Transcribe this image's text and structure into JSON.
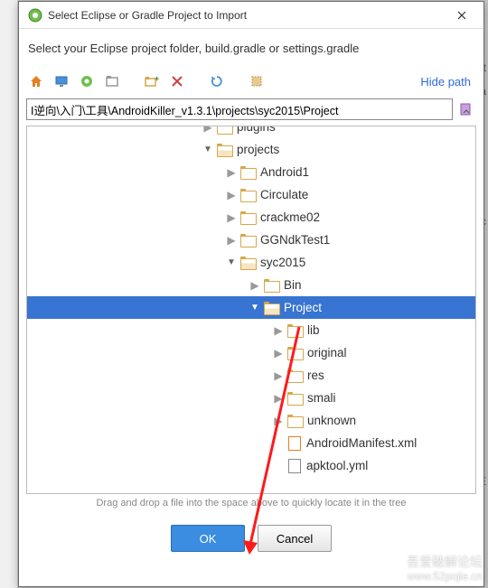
{
  "window": {
    "title": "Select Eclipse or Gradle Project to Import",
    "instruction": "Select your Eclipse project folder, build.gradle or settings.gradle"
  },
  "toolbar": {
    "hide_path": "Hide path"
  },
  "path": {
    "value": "I逆向\\入门\\工具\\AndroidKiller_v1.3.1\\projects\\syc2015\\Project"
  },
  "tree": {
    "items": [
      {
        "indent": 192,
        "arrow": "collapsed",
        "icon": "folder",
        "label": "plugins",
        "cut": true
      },
      {
        "indent": 192,
        "arrow": "expanded",
        "icon": "folder-open",
        "label": "projects"
      },
      {
        "indent": 218,
        "arrow": "collapsed",
        "icon": "folder",
        "label": "Android1"
      },
      {
        "indent": 218,
        "arrow": "collapsed",
        "icon": "folder",
        "label": "Circulate"
      },
      {
        "indent": 218,
        "arrow": "collapsed",
        "icon": "folder",
        "label": "crackme02"
      },
      {
        "indent": 218,
        "arrow": "collapsed",
        "icon": "folder",
        "label": "GGNdkTest1"
      },
      {
        "indent": 218,
        "arrow": "expanded",
        "icon": "folder-open",
        "label": "syc2015"
      },
      {
        "indent": 244,
        "arrow": "collapsed",
        "icon": "folder",
        "label": "Bin"
      },
      {
        "indent": 244,
        "arrow": "expanded",
        "icon": "folder-open",
        "label": "Project",
        "selected": true
      },
      {
        "indent": 270,
        "arrow": "collapsed",
        "icon": "folder",
        "label": "lib"
      },
      {
        "indent": 270,
        "arrow": "collapsed",
        "icon": "folder",
        "label": "original"
      },
      {
        "indent": 270,
        "arrow": "collapsed",
        "icon": "folder",
        "label": "res"
      },
      {
        "indent": 270,
        "arrow": "collapsed",
        "icon": "folder",
        "label": "smali"
      },
      {
        "indent": 270,
        "arrow": "collapsed",
        "icon": "folder",
        "label": "unknown"
      },
      {
        "indent": 270,
        "arrow": "none",
        "icon": "file-xml",
        "label": "AndroidManifest.xml"
      },
      {
        "indent": 270,
        "arrow": "none",
        "icon": "file-yml",
        "label": "apktool.yml"
      }
    ]
  },
  "hint": "Drag and drop a file into the space above to quickly locate it in the tree",
  "buttons": {
    "ok": "OK",
    "cancel": "Cancel"
  },
  "watermark": {
    "cn": "吾爱破解论坛",
    "url": "www.52pojie.cn"
  },
  "bg_chars": {
    "c1": "t",
    "c2": "a",
    "c3": "c",
    "c4": "E"
  }
}
